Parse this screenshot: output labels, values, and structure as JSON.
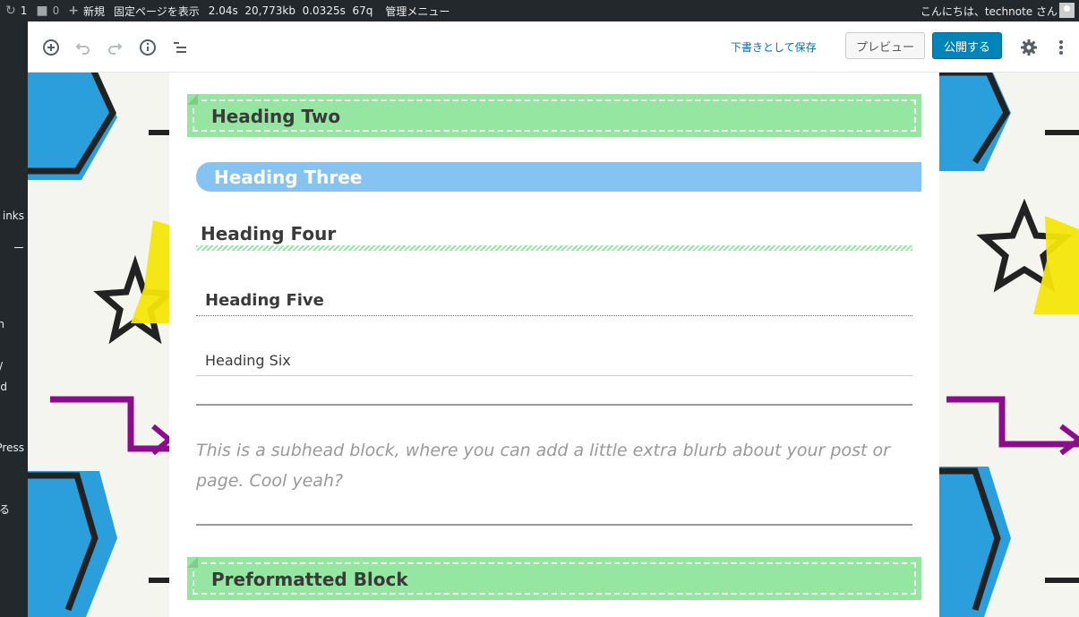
{
  "admin_bar": {
    "updates_count": "1",
    "comments_count": "0",
    "new_label": "新規",
    "view_page_label": "固定ページを表示",
    "stats": [
      "2.04s",
      "20,773kb",
      "0.0325s",
      "67q"
    ],
    "admin_menu_label": "管理メニュー",
    "greeting": "こんにちは、technote さん"
  },
  "sidebar_fragments": [
    "inks",
    "ー",
    "n",
    "/",
    "d",
    "Press",
    "る"
  ],
  "toolbar": {
    "icons": [
      "add-block-icon",
      "undo-icon",
      "redo-icon",
      "info-icon",
      "outline-icon",
      "gear-icon",
      "more-icon"
    ],
    "save_draft_label": "下書きとして保存",
    "preview_label": "プレビュー",
    "publish_label": "公開する",
    "accent_color": "#0085ba"
  },
  "blocks": {
    "heading_two": "Heading Two",
    "heading_three": "Heading Three",
    "heading_four": "Heading Four",
    "heading_five": "Heading Five",
    "heading_six": "Heading Six",
    "subhead": "This is a subhead block, where you can add a little extra blurb about your post or page. Cool yeah?",
    "preformatted_heading": "Preformatted Block"
  },
  "colors": {
    "green_heading": "#94e6a0",
    "blue_heading": "#85c4f2"
  }
}
